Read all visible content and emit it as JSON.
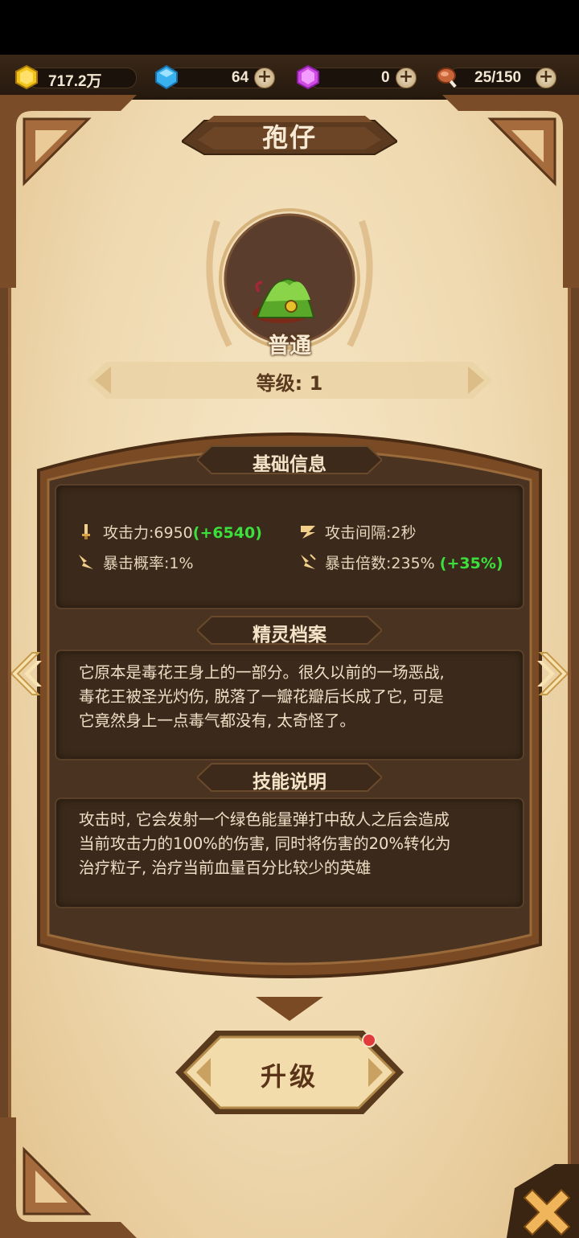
{
  "resources": {
    "gold": "717.2万",
    "diamond": "64",
    "crystal": "0",
    "stamina": "25/150",
    "plus": "+"
  },
  "title": "孢仔",
  "rarity": "普通",
  "level": "等级: 1",
  "basic_info": {
    "header": "基础信息",
    "attack_label": "攻击力:",
    "attack_value": "6950",
    "attack_bonus": "(+6540)",
    "interval_label": "攻击间隔:",
    "interval_value": "2秒",
    "crit_rate_label": "暴击概率:",
    "crit_rate_value": "1%",
    "crit_mult_label": "暴击倍数:",
    "crit_mult_value": "235%",
    "crit_mult_bonus": "(+35%)"
  },
  "profile": {
    "header": "精灵档案",
    "lines": [
      "它原本是毒花王身上的一部分。很久以前的一场恶战,",
      "毒花王被圣光灼伤, 脱落了一瓣花瓣后长成了它, 可是",
      "它竟然身上一点毒气都没有, 太奇怪了。"
    ]
  },
  "skill": {
    "header": "技能说明",
    "lines": [
      "攻击时, 它会发射一个绿色能量弹打中敌人之后会造成",
      "当前攻击力的100%的伤害, 同时将伤害的20%转化为",
      "治疗粒子, 治疗当前血量百分比较少的英雄"
    ]
  },
  "upgrade_button": "升级",
  "colors": {
    "bonus_green": "#3ce03c",
    "panel_dark": "#3b2a1b",
    "parchment": "#efd9b0"
  }
}
